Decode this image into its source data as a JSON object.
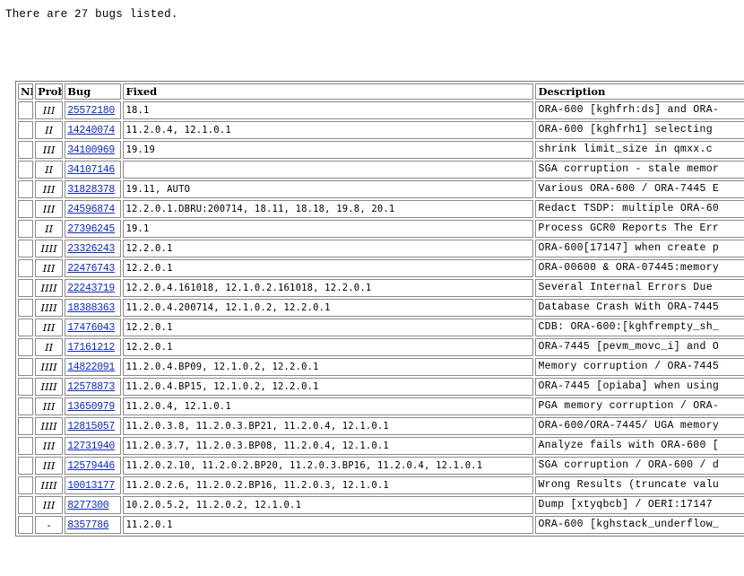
{
  "summary_text": "There are 27 bugs listed.",
  "table": {
    "headers": {
      "nb": "NB",
      "prob": "Prob",
      "bug": "Bug",
      "fixed": "Fixed",
      "description": "Description"
    },
    "rows": [
      {
        "nb": "",
        "prob": "III",
        "bug": "25572180",
        "fixed": "18.1",
        "description": "ORA-600 [kghfrh:ds] and ORA-"
      },
      {
        "nb": "",
        "prob": "II",
        "bug": "14240074",
        "fixed": "11.2.0.4, 12.1.0.1",
        "description": "ORA-600 [kghfrh1] selecting"
      },
      {
        "nb": "",
        "prob": "III",
        "bug": "34100969",
        "fixed": "19.19",
        "description": "shrink limit_size in qmxx.c"
      },
      {
        "nb": "",
        "prob": "II",
        "bug": "34107146",
        "fixed": "",
        "description": "SGA corruption - stale memor"
      },
      {
        "nb": "",
        "prob": "III",
        "bug": "31828378",
        "fixed": "19.11, AUTO",
        "description": "Various ORA-600 / ORA-7445 E"
      },
      {
        "nb": "",
        "prob": "III",
        "bug": "24596874",
        "fixed": "12.2.0.1.DBRU:200714, 18.11, 18.18, 19.8, 20.1",
        "description": "Redact TSDP: multiple ORA-60"
      },
      {
        "nb": "",
        "prob": "II",
        "bug": "27396245",
        "fixed": "19.1",
        "description": "Process GCR0 Reports The Err"
      },
      {
        "nb": "",
        "prob": "IIII",
        "bug": "23326243",
        "fixed": "12.2.0.1",
        "description": "ORA-600[17147] when create p"
      },
      {
        "nb": "",
        "prob": "III",
        "bug": "22476743",
        "fixed": "12.2.0.1",
        "description": "ORA-00600 & ORA-07445:memory"
      },
      {
        "nb": "",
        "prob": "IIII",
        "bug": "22243719",
        "fixed": "12.2.0.4.161018, 12.1.0.2.161018, 12.2.0.1",
        "description": "Several Internal Errors Due"
      },
      {
        "nb": "",
        "prob": "IIII",
        "bug": "18388363",
        "fixed": "11.2.0.4.200714, 12.1.0.2, 12.2.0.1",
        "description": "Database Crash With ORA-7445"
      },
      {
        "nb": "",
        "prob": "III",
        "bug": "17476043",
        "fixed": "12.2.0.1",
        "description": "CDB: ORA-600:[kghfrempty_sh_"
      },
      {
        "nb": "",
        "prob": "II",
        "bug": "17161212",
        "fixed": "12.2.0.1",
        "description": "ORA-7445 [pevm_movc_i] and O"
      },
      {
        "nb": "",
        "prob": "IIII",
        "bug": "14822091",
        "fixed": "11.2.0.4.BP09, 12.1.0.2, 12.2.0.1",
        "description": "Memory corruption / ORA-7445"
      },
      {
        "nb": "",
        "prob": "IIII",
        "bug": "12578873",
        "fixed": "11.2.0.4.BP15, 12.1.0.2, 12.2.0.1",
        "description": "ORA-7445 [opiaba] when using"
      },
      {
        "nb": "",
        "prob": "III",
        "bug": "13650979",
        "fixed": "11.2.0.4, 12.1.0.1",
        "description": "PGA memory corruption / ORA-"
      },
      {
        "nb": "",
        "prob": "IIII",
        "bug": "12815057",
        "fixed": "11.2.0.3.8, 11.2.0.3.BP21, 11.2.0.4, 12.1.0.1",
        "description": "ORA-600/ORA-7445/ UGA memory"
      },
      {
        "nb": "",
        "prob": "III",
        "bug": "12731940",
        "fixed": "11.2.0.3.7, 11.2.0.3.BP08, 11.2.0.4, 12.1.0.1",
        "description": "Analyze fails with ORA-600 ["
      },
      {
        "nb": "",
        "prob": "III",
        "bug": "12579446",
        "fixed": "11.2.0.2.10, 11.2.0.2.BP20, 11.2.0.3.BP16, 11.2.0.4, 12.1.0.1",
        "description": "SGA corruption / ORA-600 / d"
      },
      {
        "nb": "",
        "prob": "IIII",
        "bug": "10013177",
        "fixed": "11.2.0.2.6, 11.2.0.2.BP16, 11.2.0.3, 12.1.0.1",
        "description": "Wrong Results (truncate valu"
      },
      {
        "nb": "",
        "prob": "III",
        "bug": "8277300",
        "fixed": "10.2.0.5.2, 11.2.0.2, 12.1.0.1",
        "description": "Dump [xtyqbcb] / OERI:17147"
      },
      {
        "nb": "",
        "prob": "-",
        "bug": "8357786",
        "fixed": "11.2.0.1",
        "description": "ORA-600 [kghstack_underflow_"
      }
    ]
  }
}
